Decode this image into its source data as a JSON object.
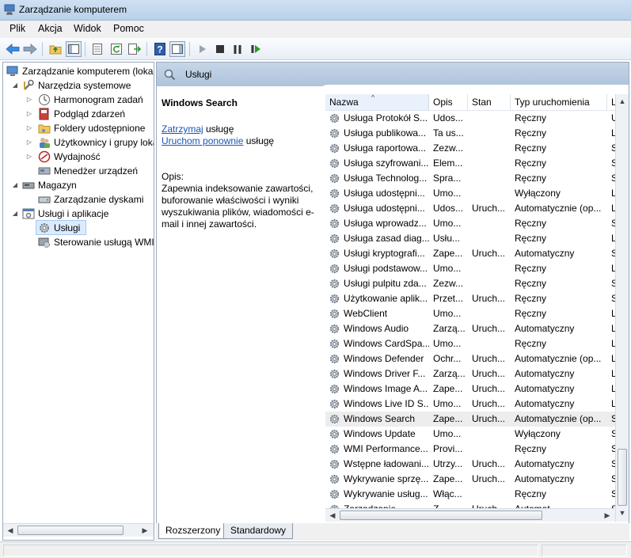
{
  "window": {
    "title": "Zarządzanie komputerem"
  },
  "menu": [
    "Plik",
    "Akcja",
    "Widok",
    "Pomoc"
  ],
  "toolbar": {
    "buttons": [
      "back-icon",
      "forward-icon",
      "up-folder-icon",
      "show-hide-tree-icon",
      "export-list-icon",
      "refresh-icon",
      "export-icon",
      "help-icon",
      "show-hide-action-pane-icon",
      "start-icon",
      "stop-icon",
      "pause-icon",
      "resume-icon"
    ]
  },
  "tree": {
    "root": "Zarządzanie komputerem (lokalne)",
    "system_tools": "Narzędzia systemowe",
    "task_scheduler": "Harmonogram zadań",
    "event_viewer": "Podgląd zdarzeń",
    "shared_folders": "Foldery udostępnione",
    "local_users": "Użytkownicy i grupy lokalne",
    "performance": "Wydajność",
    "device_manager": "Menedżer urządzeń",
    "storage": "Magazyn",
    "disk_management": "Zarządzanie dyskami",
    "services_apps": "Usługi i aplikacje",
    "services": "Usługi",
    "wmi_control": "Sterowanie usługą WMI"
  },
  "panel": {
    "title": "Usługi",
    "selected_service": "Windows Search",
    "stop_link": "Zatrzymaj",
    "stop_suffix": " usługę",
    "restart_link": "Uruchom ponownie",
    "restart_suffix": " usługę",
    "desc_label": "Opis:",
    "desc_text": "Zapewnia indeksowanie zawartości, buforowanie właściwości i wyniki wyszukiwania plików, wiadomości e-mail i innej zawartości."
  },
  "columns": [
    "Nazwa",
    "Opis",
    "Stan",
    "Typ uruchomienia",
    "Lo"
  ],
  "rows": [
    [
      "Usługa Protokół S...",
      "Udos...",
      "",
      "Ręczny",
      "U"
    ],
    [
      "Usługa publikowa...",
      "Ta us...",
      "",
      "Ręczny",
      "L"
    ],
    [
      "Usługa raportowa...",
      "Zezw...",
      "",
      "Ręczny",
      "S"
    ],
    [
      "Usługa szyfrowani...",
      "Elem...",
      "",
      "Ręczny",
      "S"
    ],
    [
      "Usługa Technolog...",
      "Spra...",
      "",
      "Ręczny",
      "S"
    ],
    [
      "Usługa udostępni...",
      "Umo...",
      "",
      "Wyłączony",
      "L"
    ],
    [
      "Usługa udostępni...",
      "Udos...",
      "Uruch...",
      "Automatycznie (op...",
      "L"
    ],
    [
      "Usługa wprowadz...",
      "Umo...",
      "",
      "Ręczny",
      "S"
    ],
    [
      "Usługa zasad diag...",
      "Usłu...",
      "",
      "Ręczny",
      "L"
    ],
    [
      "Usługi kryptografi...",
      "Zape...",
      "Uruch...",
      "Automatyczny",
      "S"
    ],
    [
      "Usługi podstawow...",
      "Umo...",
      "",
      "Ręczny",
      "L"
    ],
    [
      "Usługi pulpitu zda...",
      "Zezw...",
      "",
      "Ręczny",
      "S"
    ],
    [
      "Użytkowanie aplik...",
      "Przet...",
      "Uruch...",
      "Ręczny",
      "S"
    ],
    [
      "WebClient",
      "Umo...",
      "",
      "Ręczny",
      "L"
    ],
    [
      "Windows Audio",
      "Zarzą...",
      "Uruch...",
      "Automatyczny",
      "L"
    ],
    [
      "Windows CardSpa...",
      "Umo...",
      "",
      "Ręczny",
      "L"
    ],
    [
      "Windows Defender",
      "Ochr...",
      "Uruch...",
      "Automatycznie (op...",
      "L"
    ],
    [
      "Windows Driver F...",
      "Zarzą...",
      "Uruch...",
      "Automatyczny",
      "L"
    ],
    [
      "Windows Image A...",
      "Zape...",
      "Uruch...",
      "Automatyczny",
      "L"
    ],
    [
      "Windows Live ID S...",
      "Umo...",
      "Uruch...",
      "Automatyczny",
      "L"
    ],
    [
      "Windows Search",
      "Zape...",
      "Uruch...",
      "Automatycznie (op...",
      "S"
    ],
    [
      "Windows Update",
      "Umo...",
      "",
      "Wyłączony",
      "S"
    ],
    [
      "WMI Performance...",
      "Provi...",
      "",
      "Ręczny",
      "S"
    ],
    [
      "Wstępne ładowani...",
      "Utrzy...",
      "Uruch...",
      "Automatyczny",
      "S"
    ],
    [
      "Wykrywanie sprzę...",
      "Zape...",
      "Uruch...",
      "Automatyczny",
      "S"
    ],
    [
      "Wykrywanie usług...",
      "Włąc...",
      "",
      "Ręczny",
      "S"
    ],
    [
      "Zarządzanie ...",
      "Z...",
      "Uruch...",
      "Automat...",
      "S"
    ]
  ],
  "selected_row": 20,
  "tabs": [
    "Rozszerzony",
    "Standardowy"
  ],
  "colors": {
    "accent": "#1a55b4",
    "header_band": "#b7cbe1",
    "selection": "#dcebfc"
  }
}
